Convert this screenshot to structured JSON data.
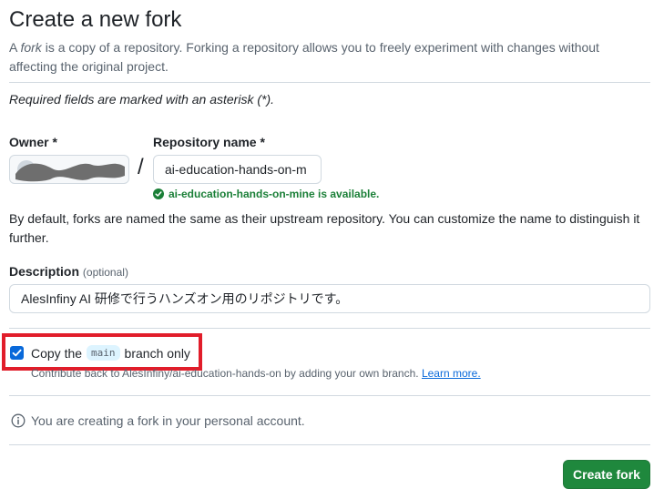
{
  "header": {
    "title": "Create a new fork",
    "subtitle_prefix": "A ",
    "subtitle_em": "fork",
    "subtitle_rest": " is a copy of a repository. Forking a repository allows you to freely experiment with changes without affecting the original project."
  },
  "form": {
    "required_note": "Required fields are marked with an asterisk (*).",
    "owner_label": "Owner *",
    "separator": "/",
    "repo_label": "Repository name *",
    "repo_value": "ai-education-hands-on-m",
    "availability": "ai-education-hands-on-mine is available.",
    "default_note": "By default, forks are named the same as their upstream repository. You can customize the name to distinguish it further.",
    "description_label": "Description",
    "description_optional": "(optional)",
    "description_value": "AlesInfiny AI 研修で行うハンズオン用のリポジトリです。",
    "copy_label_before": "Copy the",
    "copy_branch": "main",
    "copy_label_after": "branch only",
    "copy_checked": true,
    "contribute_text": "Contribute back to AlesInfiny/ai-education-hands-on by adding your own branch.",
    "learn_more": "Learn more.",
    "info_text": "You are creating a fork in your personal account.",
    "create_button": "Create fork"
  },
  "icons": {
    "availability": "check-circle-icon",
    "checkbox": "check-icon",
    "info": "info-icon"
  },
  "colors": {
    "primary_button": "#1f883d",
    "success_text": "#1a7f37",
    "link": "#0969da",
    "highlight_border": "#e11d2a",
    "checkbox": "#0969da"
  }
}
